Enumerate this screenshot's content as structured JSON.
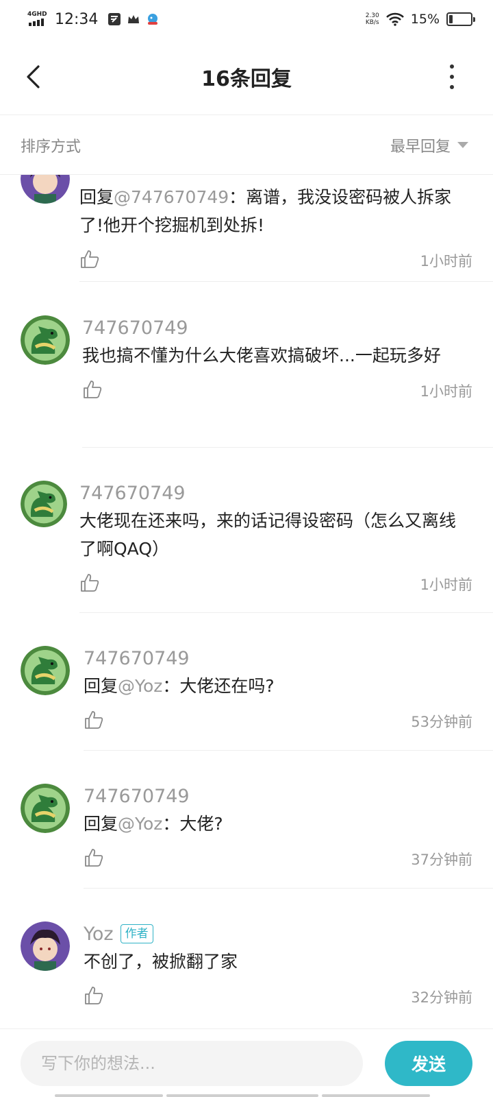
{
  "status_bar": {
    "network": "4GHD",
    "time": "12:34",
    "speed_value": "2.30",
    "speed_unit": "KB/s",
    "battery_text": "15%",
    "battery_level": 0.15,
    "icons": [
      "app-notification-icon",
      "crown-icon",
      "bird-app-icon"
    ]
  },
  "header": {
    "title": "16条回复"
  },
  "sort": {
    "label": "排序方式",
    "selected": "最早回复"
  },
  "replies": [
    {
      "user": "",
      "avatar": "anime-avatar",
      "prefix": "回复",
      "mention": "@747670749",
      "text": "：离谱，我没设密码被人拆家了!他开个挖掘机到处拆!",
      "time": "1小时前"
    },
    {
      "user": "747670749",
      "avatar": "dino-avatar",
      "prefix": "",
      "mention": "",
      "text": "我也搞不懂为什么大佬喜欢搞破坏...一起玩多好",
      "time": "1小时前"
    },
    {
      "user": "747670749",
      "avatar": "dino-avatar",
      "prefix": "",
      "mention": "",
      "text": "大佬现在还来吗，来的话记得设密码（怎么又离线了啊QAQ）",
      "time": "1小时前"
    },
    {
      "user": "747670749",
      "avatar": "dino-avatar",
      "prefix": "回复",
      "mention": "@Yoz",
      "text": "：大佬还在吗?",
      "time": "53分钟前"
    },
    {
      "user": "747670749",
      "avatar": "dino-avatar",
      "prefix": "回复",
      "mention": "@Yoz",
      "text": "：大佬?",
      "time": "37分钟前"
    },
    {
      "user": "Yoz",
      "badge": "作者",
      "avatar": "anime-avatar",
      "prefix": "",
      "mention": "",
      "text": "不创了，被掀翻了家",
      "time": "32分钟前"
    }
  ],
  "input": {
    "placeholder": "写下你的想法..."
  },
  "send_label": "发送",
  "colors": {
    "accent": "#2fb8c8",
    "muted_text": "#999999",
    "divider": "#eeeeee"
  }
}
